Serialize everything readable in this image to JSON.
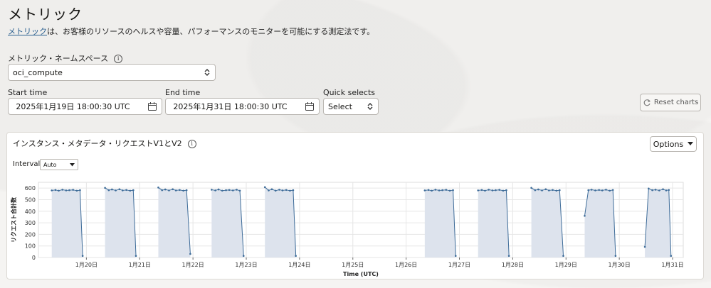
{
  "page": {
    "title": "メトリック",
    "description_link": "メトリック",
    "description_rest": "は、お客様のリソースのヘルスや容量、パフォーマンスのモニターを可能にする測定法です。"
  },
  "namespace": {
    "label": "メトリック・ネームスペース",
    "value": "oci_compute"
  },
  "time": {
    "start_label": "Start time",
    "start_value": "2025年1月19日 18:00:30 UTC",
    "end_label": "End time",
    "end_value": "2025年1月31日 18:00:30 UTC",
    "quick_label": "Quick selects",
    "quick_value": "Select",
    "reset_label": "Reset charts"
  },
  "panel": {
    "title": "インスタンス・メタデータ・リクエストV1とV2",
    "options_label": "Options",
    "interval_label": "Interval",
    "interval_value": "Auto"
  },
  "chart_data": {
    "type": "area",
    "title": "",
    "xlabel": "Time (UTC)",
    "ylabel": "リクエスト合計数",
    "ylim": [
      0,
      650
    ],
    "yticks": [
      0,
      100,
      200,
      300,
      400,
      500,
      600
    ],
    "xlim": [
      19.1,
      31.2
    ],
    "xticks": [
      {
        "v": 20,
        "label": "1月20日"
      },
      {
        "v": 21,
        "label": "1月21日"
      },
      {
        "v": 22,
        "label": "1月22日"
      },
      {
        "v": 23,
        "label": "1月23日"
      },
      {
        "v": 24,
        "label": "1月24日"
      },
      {
        "v": 25,
        "label": "1月25日"
      },
      {
        "v": 26,
        "label": "1月26日"
      },
      {
        "v": 27,
        "label": "1月27日"
      },
      {
        "v": 28,
        "label": "1月28日"
      },
      {
        "v": 29,
        "label": "1月29日"
      },
      {
        "v": 30,
        "label": "1月30日"
      },
      {
        "v": 31,
        "label": "1月31日"
      }
    ],
    "grid": true,
    "colors": {
      "fill": "#dde3ed",
      "line": "#3e6c99",
      "grid": "#e6e6e6"
    },
    "segments": [
      [
        [
          19.35,
          580
        ],
        [
          19.42,
          584
        ],
        [
          19.48,
          578
        ],
        [
          19.55,
          586
        ],
        [
          19.62,
          580
        ],
        [
          19.68,
          582
        ],
        [
          19.75,
          585
        ],
        [
          19.82,
          578
        ],
        [
          19.88,
          582
        ],
        [
          19.93,
          14
        ]
      ],
      [
        [
          20.35,
          602
        ],
        [
          20.42,
          582
        ],
        [
          20.48,
          588
        ],
        [
          20.55,
          580
        ],
        [
          20.62,
          590
        ],
        [
          20.68,
          580
        ],
        [
          20.75,
          584
        ],
        [
          20.82,
          578
        ],
        [
          20.88,
          582
        ],
        [
          20.93,
          14
        ]
      ],
      [
        [
          21.35,
          605
        ],
        [
          21.42,
          582
        ],
        [
          21.48,
          588
        ],
        [
          21.55,
          580
        ],
        [
          21.62,
          590
        ],
        [
          21.68,
          580
        ],
        [
          21.75,
          584
        ],
        [
          21.82,
          578
        ],
        [
          21.88,
          582
        ],
        [
          21.95,
          31
        ]
      ],
      [
        [
          22.35,
          586
        ],
        [
          22.42,
          580
        ],
        [
          22.48,
          588
        ],
        [
          22.55,
          578
        ],
        [
          22.62,
          582
        ],
        [
          22.68,
          584
        ],
        [
          22.75,
          580
        ],
        [
          22.82,
          586
        ],
        [
          22.88,
          578
        ],
        [
          22.95,
          14
        ]
      ],
      [
        [
          23.35,
          608
        ],
        [
          23.42,
          580
        ],
        [
          23.48,
          590
        ],
        [
          23.55,
          578
        ],
        [
          23.62,
          586
        ],
        [
          23.68,
          580
        ],
        [
          23.75,
          584
        ],
        [
          23.82,
          578
        ],
        [
          23.88,
          582
        ],
        [
          23.93,
          14
        ]
      ],
      [
        [
          26.35,
          580
        ],
        [
          26.42,
          584
        ],
        [
          26.48,
          578
        ],
        [
          26.55,
          586
        ],
        [
          26.62,
          580
        ],
        [
          26.68,
          582
        ],
        [
          26.75,
          585
        ],
        [
          26.82,
          578
        ],
        [
          26.88,
          582
        ],
        [
          26.93,
          14
        ]
      ],
      [
        [
          27.35,
          580
        ],
        [
          27.42,
          584
        ],
        [
          27.48,
          578
        ],
        [
          27.55,
          586
        ],
        [
          27.62,
          580
        ],
        [
          27.68,
          582
        ],
        [
          27.75,
          585
        ],
        [
          27.82,
          578
        ],
        [
          27.88,
          582
        ],
        [
          27.93,
          14
        ]
      ],
      [
        [
          28.35,
          602
        ],
        [
          28.42,
          582
        ],
        [
          28.48,
          588
        ],
        [
          28.55,
          580
        ],
        [
          28.62,
          590
        ],
        [
          28.68,
          580
        ],
        [
          28.75,
          584
        ],
        [
          28.82,
          578
        ],
        [
          28.88,
          582
        ],
        [
          28.95,
          14
        ]
      ],
      [
        [
          29.35,
          360
        ],
        [
          29.42,
          582
        ],
        [
          29.48,
          586
        ],
        [
          29.55,
          580
        ],
        [
          29.62,
          584
        ],
        [
          29.68,
          580
        ],
        [
          29.75,
          586
        ],
        [
          29.82,
          578
        ],
        [
          29.88,
          584
        ],
        [
          29.93,
          14
        ]
      ],
      [
        [
          30.48,
          92
        ],
        [
          30.55,
          596
        ],
        [
          30.62,
          582
        ],
        [
          30.68,
          586
        ],
        [
          30.75,
          580
        ],
        [
          30.82,
          590
        ],
        [
          30.88,
          580
        ],
        [
          30.93,
          584
        ],
        [
          30.97,
          14
        ]
      ]
    ]
  }
}
